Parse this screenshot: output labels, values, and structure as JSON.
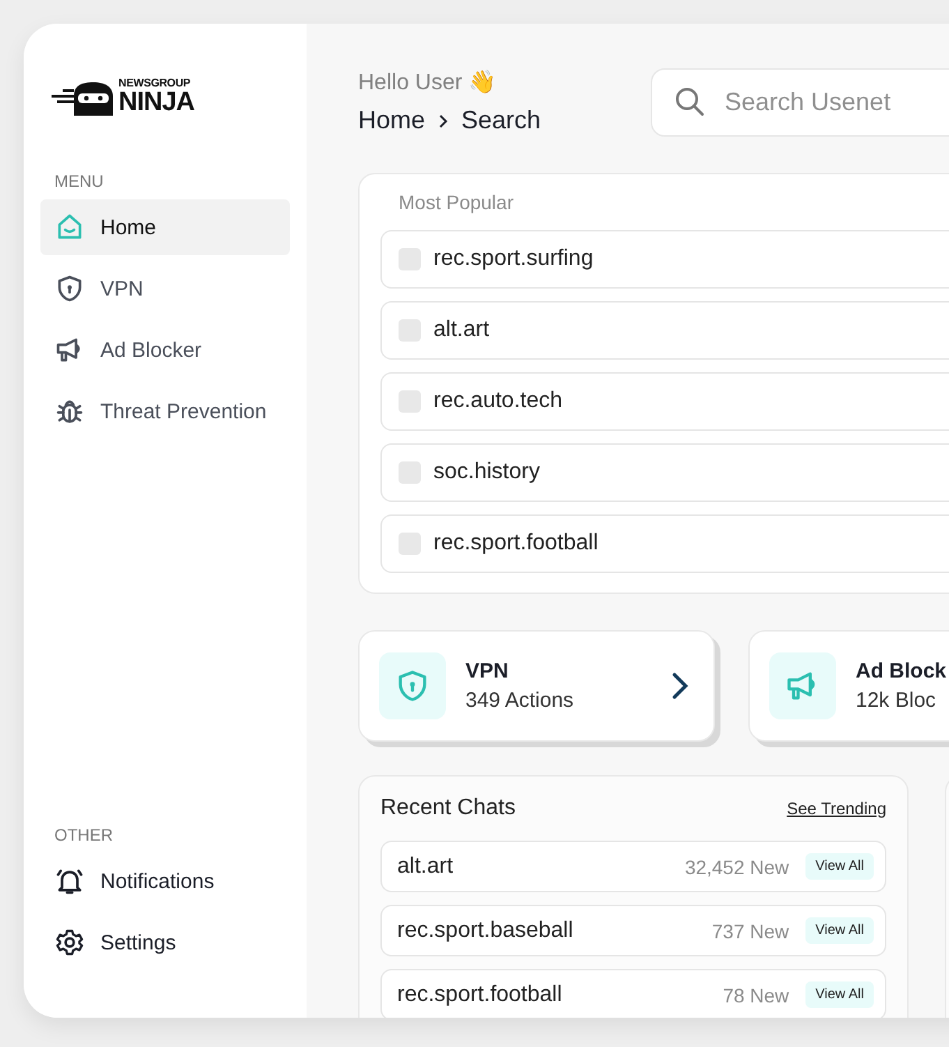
{
  "logo": {
    "top": "NEWSGROUP",
    "bottom": "NINJA"
  },
  "sidebar": {
    "menu_label": "MENU",
    "items": [
      {
        "label": "Home",
        "selected": true
      },
      {
        "label": "VPN",
        "selected": false
      },
      {
        "label": "Ad Blocker",
        "selected": false
      },
      {
        "label": "Threat Prevention",
        "selected": false
      }
    ],
    "other_label": "OTHER",
    "other_items": [
      {
        "label": "Notifications",
        "selected": false
      },
      {
        "label": "Settings",
        "selected": false
      }
    ]
  },
  "header": {
    "greeting": "Hello User 👋",
    "breadcrumb": [
      "Home",
      "Search"
    ]
  },
  "search": {
    "placeholder": "Search Usenet"
  },
  "most_popular": {
    "title": "Most Popular",
    "items": [
      {
        "label": "rec.sport.surfing",
        "checked": false
      },
      {
        "label": "alt.art",
        "checked": false
      },
      {
        "label": "rec.auto.tech",
        "checked": false
      },
      {
        "label": "soc.history",
        "checked": false
      },
      {
        "label": "rec.sport.football",
        "checked": false
      }
    ]
  },
  "stat_cards": [
    {
      "title": "VPN",
      "subtitle": "349 Actions"
    },
    {
      "title": "Ad Block",
      "subtitle": "12k Bloc"
    }
  ],
  "recent_chats": {
    "title": "Recent Chats",
    "link": "See Trending",
    "rows": [
      {
        "name": "alt.art",
        "count": "32,452 New",
        "button": "View All"
      },
      {
        "name": "rec.sport.baseball",
        "count": "737 New",
        "button": "View All"
      },
      {
        "name": "rec.sport.football",
        "count": "78 New",
        "button": "View All"
      }
    ]
  }
}
